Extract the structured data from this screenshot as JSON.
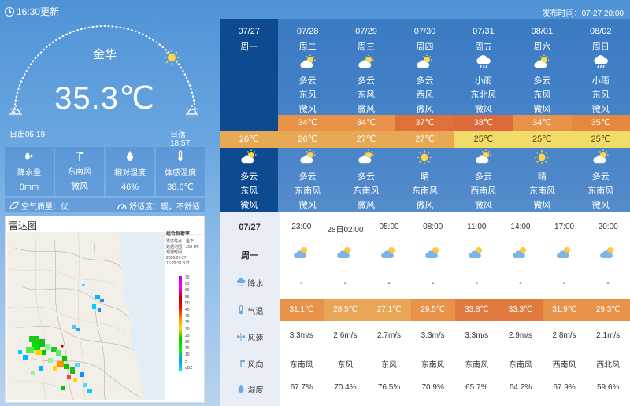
{
  "header": {
    "update_time": "16:30更新",
    "publish": "发布时间：07-27 20:00"
  },
  "current": {
    "city": "金华",
    "temperature": "35.3℃",
    "sunrise": "日出05:19",
    "sunset": "日落18:57",
    "stats": [
      {
        "label": "降水量",
        "value": "0mm",
        "icon": "raindrop-icon"
      },
      {
        "label": "东南风",
        "value": "微风",
        "icon": "wind-vane-icon"
      },
      {
        "label": "相对湿度",
        "value": "46%",
        "icon": "humidity-icon"
      },
      {
        "label": "体感温度",
        "value": "38.6℃",
        "icon": "thermometer-icon"
      }
    ],
    "air_quality": "空气质量：优",
    "comfort": "舒适度：暖，不舒适"
  },
  "radar": {
    "title": "雷达图",
    "legend_title": "组合反射率",
    "legend_lines": [
      "雷达站点：金华",
      "数据范围：258 km",
      "观测时间：",
      "2026-07-27",
      "16:29:33 BJT"
    ],
    "legend_values": [
      "70",
      "65",
      "60",
      "55",
      "50",
      "45",
      "40",
      "35",
      "30",
      "25",
      "20",
      "15",
      "10",
      "5",
      "dBZ"
    ]
  },
  "forecast": {
    "days": [
      {
        "date": "07/27",
        "weekday": "周一",
        "day_weather": "",
        "day_wind": "",
        "day_wind_level": "",
        "high": "",
        "low": "26℃",
        "night_weather": "多云",
        "night_wind": "东风",
        "night_wind_level": "微风",
        "day_icon": "",
        "night_icon": "partly-cloudy-icon"
      },
      {
        "date": "07/28",
        "weekday": "周二",
        "day_weather": "多云",
        "day_wind": "东风",
        "day_wind_level": "微风",
        "high": "34℃",
        "low": "26℃",
        "night_weather": "多云",
        "night_wind": "东南风",
        "night_wind_level": "微风",
        "day_icon": "partly-cloudy-icon",
        "night_icon": "partly-cloudy-icon"
      },
      {
        "date": "07/29",
        "weekday": "周三",
        "day_weather": "多云",
        "day_wind": "东风",
        "day_wind_level": "微风",
        "high": "34℃",
        "low": "27℃",
        "night_weather": "多云",
        "night_wind": "东南风",
        "night_wind_level": "微风",
        "day_icon": "partly-cloudy-icon",
        "night_icon": "partly-cloudy-icon"
      },
      {
        "date": "07/30",
        "weekday": "周四",
        "day_weather": "多云",
        "day_wind": "西风",
        "day_wind_level": "微风",
        "high": "37℃",
        "low": "27℃",
        "night_weather": "晴",
        "night_wind": "东南风",
        "night_wind_level": "微风",
        "day_icon": "partly-cloudy-icon",
        "night_icon": "sunny-icon"
      },
      {
        "date": "07/31",
        "weekday": "周五",
        "day_weather": "小雨",
        "day_wind": "东北风",
        "day_wind_level": "微风",
        "high": "38℃",
        "low": "25℃",
        "night_weather": "多云",
        "night_wind": "西南风",
        "night_wind_level": "微风",
        "day_icon": "light-rain-icon",
        "night_icon": "partly-cloudy-icon"
      },
      {
        "date": "08/01",
        "weekday": "周六",
        "day_weather": "多云",
        "day_wind": "东风",
        "day_wind_level": "微风",
        "high": "34℃",
        "low": "25℃",
        "night_weather": "晴",
        "night_wind": "东南风",
        "night_wind_level": "微风",
        "day_icon": "partly-cloudy-icon",
        "night_icon": "sunny-icon"
      },
      {
        "date": "08/02",
        "weekday": "周日",
        "day_weather": "小雨",
        "day_wind": "东风",
        "day_wind_level": "微风",
        "high": "35℃",
        "low": "25℃",
        "night_weather": "多云",
        "night_wind": "东南风",
        "night_wind_level": "微风",
        "day_icon": "light-rain-icon",
        "night_icon": "partly-cloudy-icon"
      }
    ],
    "high_colors": [
      "",
      "#e9934a",
      "#e9934a",
      "#e0703a",
      "#dd6a3a",
      "#e9934a",
      "#e6873f"
    ],
    "low_colors": [
      "#e8a954",
      "#e8a954",
      "#e8a954",
      "#e8a954",
      "#f1dc6a",
      "#f1dc6a",
      "#f1dc6a"
    ]
  },
  "hourly": {
    "today_date": "07/27",
    "today_weekday": "周一",
    "times": [
      "23:00",
      "28日02:00",
      "05:00",
      "08:00",
      "11:00",
      "14:00",
      "17:00",
      "20:00"
    ],
    "rain": [
      "-",
      "-",
      "-",
      "-",
      "-",
      "-",
      "-",
      "-"
    ],
    "temps": [
      "31.1℃",
      "28.5℃",
      "27.1℃",
      "29.5℃",
      "33.8℃",
      "33.3℃",
      "31.9℃",
      "29.3℃"
    ],
    "temp_colors": [
      "#e9934a",
      "#e9a656",
      "#e9a656",
      "#e9934a",
      "#e07a3f",
      "#e07a3f",
      "#e9934a",
      "#e9934a"
    ],
    "wind_speed": [
      "3.3m/s",
      "2.6m/s",
      "2.7m/s",
      "3.3m/s",
      "3.3m/s",
      "2.9m/s",
      "2.8m/s",
      "2.1m/s"
    ],
    "wind_dir": [
      "东南风",
      "东风",
      "东风",
      "东南风",
      "东南风",
      "东南风",
      "西南风",
      "西北风"
    ],
    "humidity": [
      "67.7%",
      "70.4%",
      "76.5%",
      "70.9%",
      "65.7%",
      "64.2%",
      "67.9%",
      "59.6%"
    ],
    "labels": {
      "rain": "降水",
      "temp": "气温",
      "wind_speed": "风速",
      "wind_dir": "风向",
      "humidity": "湿度"
    }
  }
}
